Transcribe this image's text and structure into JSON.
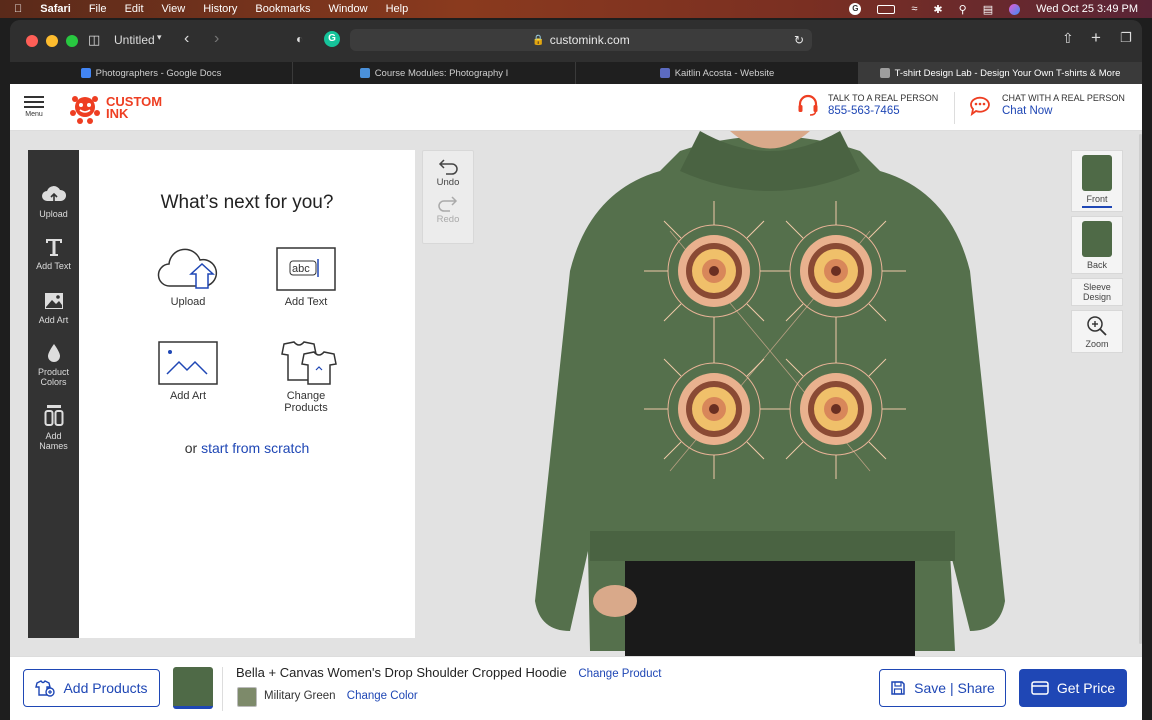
{
  "menubar": {
    "app": "Safari",
    "items": [
      "File",
      "Edit",
      "View",
      "History",
      "Bookmarks",
      "Window",
      "Help"
    ],
    "clock": "Wed Oct 25  3:49 PM"
  },
  "browser": {
    "tab_group": "Untitled",
    "url": "customink.com",
    "tabs": [
      {
        "label": "Photographers - Google Docs",
        "color": "#4285f4"
      },
      {
        "label": "Course Modules: Photography I",
        "color": "#4a90d9"
      },
      {
        "label": "Kaitlin Acosta - Website",
        "color": "#5c6bc0"
      },
      {
        "label": "T-shirt Design Lab - Design Your Own T-shirts & More",
        "color": "#9e9e9e"
      }
    ]
  },
  "header": {
    "menu_label": "Menu",
    "logo_line1": "CUSTOM",
    "logo_line2": "INK",
    "talk_label": "TALK TO A REAL PERSON",
    "talk_phone": "855-563-7465",
    "chat_label": "CHAT WITH A REAL PERSON",
    "chat_link": "Chat Now"
  },
  "rail": {
    "items": [
      "Upload",
      "Add Text",
      "Add Art",
      "Product Colors",
      "Add Names"
    ]
  },
  "panel": {
    "title": "What’s next for you?",
    "options": [
      "Upload",
      "Add Text",
      "Add Art",
      "Change Products"
    ],
    "scratch_prefix": "or ",
    "scratch_link": "start from scratch",
    "abc_sample": "abc"
  },
  "history": {
    "undo": "Undo",
    "redo": "Redo"
  },
  "views": [
    "Front",
    "Back",
    "Sleeve Design",
    "Zoom"
  ],
  "footer": {
    "add_products": "Add Products",
    "product_name": "Bella + Canvas Women's Drop Shoulder Cropped Hoodie",
    "change_product": "Change Product",
    "color_name": "Military Green",
    "change_color": "Change Color",
    "save_share": "Save | Share",
    "get_price": "Get Price"
  },
  "colors": {
    "brand": "#ee3e22",
    "accent": "#1f47b5",
    "hoodie": "#4f6a47",
    "swatch": "#7d8a6a"
  }
}
